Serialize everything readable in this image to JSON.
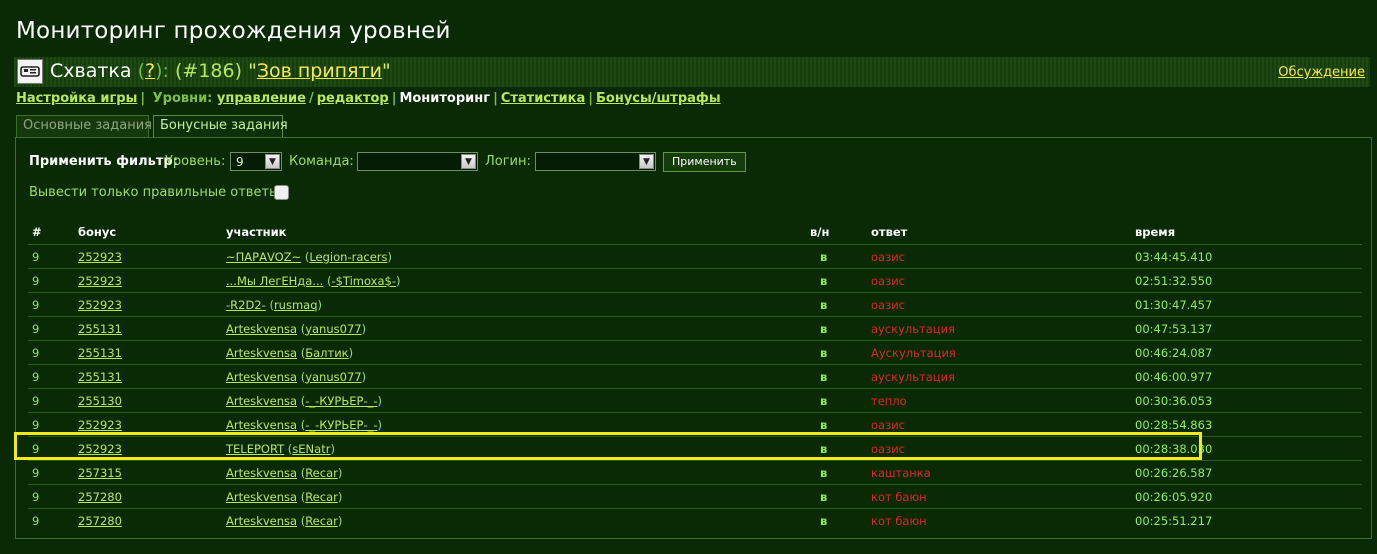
{
  "page": {
    "title": "Мониторинг прохождения уровней"
  },
  "game": {
    "type": "Схватка",
    "help": "?",
    "colon": ":",
    "paren_open": "(",
    "number": "#186",
    "paren_close": ")",
    "quote_open": "\"",
    "name": "Зов припяти",
    "quote_close": "\"",
    "discussion_link": "Обсуждение",
    "icon": "game-card-icon"
  },
  "nav": {
    "settings": "Настройка игры",
    "sep": "|",
    "levels_prefix": "Уровни:",
    "manage": "управление",
    "slash": "/",
    "editor": "редактор",
    "monitoring": "Мониторинг",
    "stats": "Статистика",
    "bonuses": "Бонусы/штрафы"
  },
  "tabs": {
    "main_tasks": "Основные задания",
    "bonus_tasks": "Бонусные задания"
  },
  "filter": {
    "apply_label": "Применить фильтр:",
    "level_label": "Уровень:",
    "level_value": "9",
    "team_label": "Команда:",
    "team_value": "",
    "login_label": "Логин:",
    "login_value": "",
    "apply_button": "Применить",
    "only_right_label": "Вывести только правильные ответы:"
  },
  "table": {
    "headers": {
      "num": "#",
      "bonus": "бонус",
      "player": "участник",
      "ok": "в/н",
      "answer": "ответ",
      "time": "время"
    },
    "rows": [
      {
        "num": "9",
        "bonus": "252923",
        "player": "~ПАРАVOZ~",
        "team": "Legion-racers",
        "ok": "в",
        "answer": "оазис",
        "time": "03:44:45.410"
      },
      {
        "num": "9",
        "bonus": "252923",
        "player": "...Мы ЛегЕНда...",
        "team": "-$Timoxa$-",
        "ok": "в",
        "answer": "оазис",
        "time": "02:51:32.550"
      },
      {
        "num": "9",
        "bonus": "252923",
        "player": "-R2D2-",
        "team": "rusmaq",
        "ok": "в",
        "answer": "оазис",
        "time": "01:30:47.457"
      },
      {
        "num": "9",
        "bonus": "255131",
        "player": "Arteskvensa",
        "team": "yanus077",
        "ok": "в",
        "answer": "аускультация",
        "time": "00:47:53.137"
      },
      {
        "num": "9",
        "bonus": "255131",
        "player": "Arteskvensa",
        "team": "Балтик",
        "ok": "в",
        "answer": "Аускультация",
        "time": "00:46:24.087"
      },
      {
        "num": "9",
        "bonus": "255131",
        "player": "Arteskvensa",
        "team": "yanus077",
        "ok": "в",
        "answer": "аускультация",
        "time": "00:46:00.977"
      },
      {
        "num": "9",
        "bonus": "255130",
        "player": "Arteskvensa",
        "team": "-_-КУРЬЕР-_-",
        "ok": "в",
        "answer": "тепло",
        "time": "00:30:36.053"
      },
      {
        "num": "9",
        "bonus": "252923",
        "player": "Arteskvensa",
        "team": "-_-КУРЬЕР-_-",
        "ok": "в",
        "answer": "оазис",
        "time": "00:28:54.863"
      },
      {
        "num": "9",
        "bonus": "252923",
        "player": "TELEPORT",
        "team": "sENatr",
        "ok": "в",
        "answer": "оазис",
        "time": "00:28:38.030"
      },
      {
        "num": "9",
        "bonus": "257315",
        "player": "Arteskvensa",
        "team": "Recar",
        "ok": "в",
        "answer": "каштанка",
        "time": "00:26:26.587"
      },
      {
        "num": "9",
        "bonus": "257280",
        "player": "Arteskvensa",
        "team": "Recar",
        "ok": "в",
        "answer": "кот баюн",
        "time": "00:26:05.920"
      },
      {
        "num": "9",
        "bonus": "257280",
        "player": "Arteskvensa",
        "team": "Recar",
        "ok": "в",
        "answer": "кот баюн",
        "time": "00:25:51.217"
      }
    ],
    "highlighted_row": 8
  },
  "colors": {
    "highlight": "#f2ea1a",
    "answer": "#e0262a",
    "time": "#8ff04d",
    "link": "#b6e85a"
  }
}
